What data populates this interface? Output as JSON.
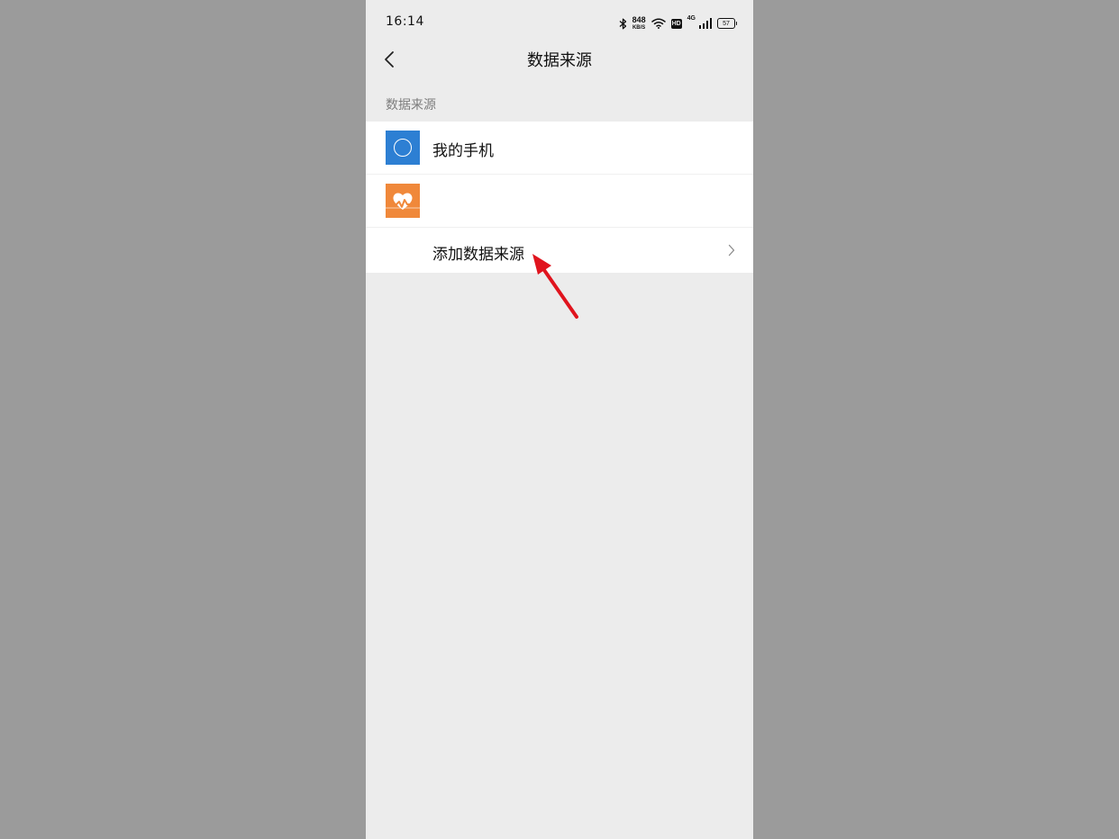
{
  "status_bar": {
    "time": "16:14",
    "net_speed_value": "848",
    "net_speed_unit": "KB/S",
    "hd_label": "HD",
    "network_type": "4G",
    "battery_level": "57",
    "icons": [
      "bluetooth-icon",
      "wifi-icon",
      "signal-icon",
      "battery-icon"
    ]
  },
  "nav": {
    "title": "数据来源",
    "back_icon": "back-chevron-icon"
  },
  "section": {
    "label": "数据来源"
  },
  "sources": [
    {
      "label": "我的手机",
      "icon": "my-phone-icon",
      "icon_color": "#2d7fd3"
    },
    {
      "label": "",
      "icon": "health-heart-icon",
      "icon_color": "#f0883a"
    }
  ],
  "add_source": {
    "label": "添加数据来源",
    "icon": "chevron-right-icon"
  },
  "annotation": {
    "type": "red-arrow",
    "color": "#e0141e",
    "target": "add-data-source-row"
  }
}
